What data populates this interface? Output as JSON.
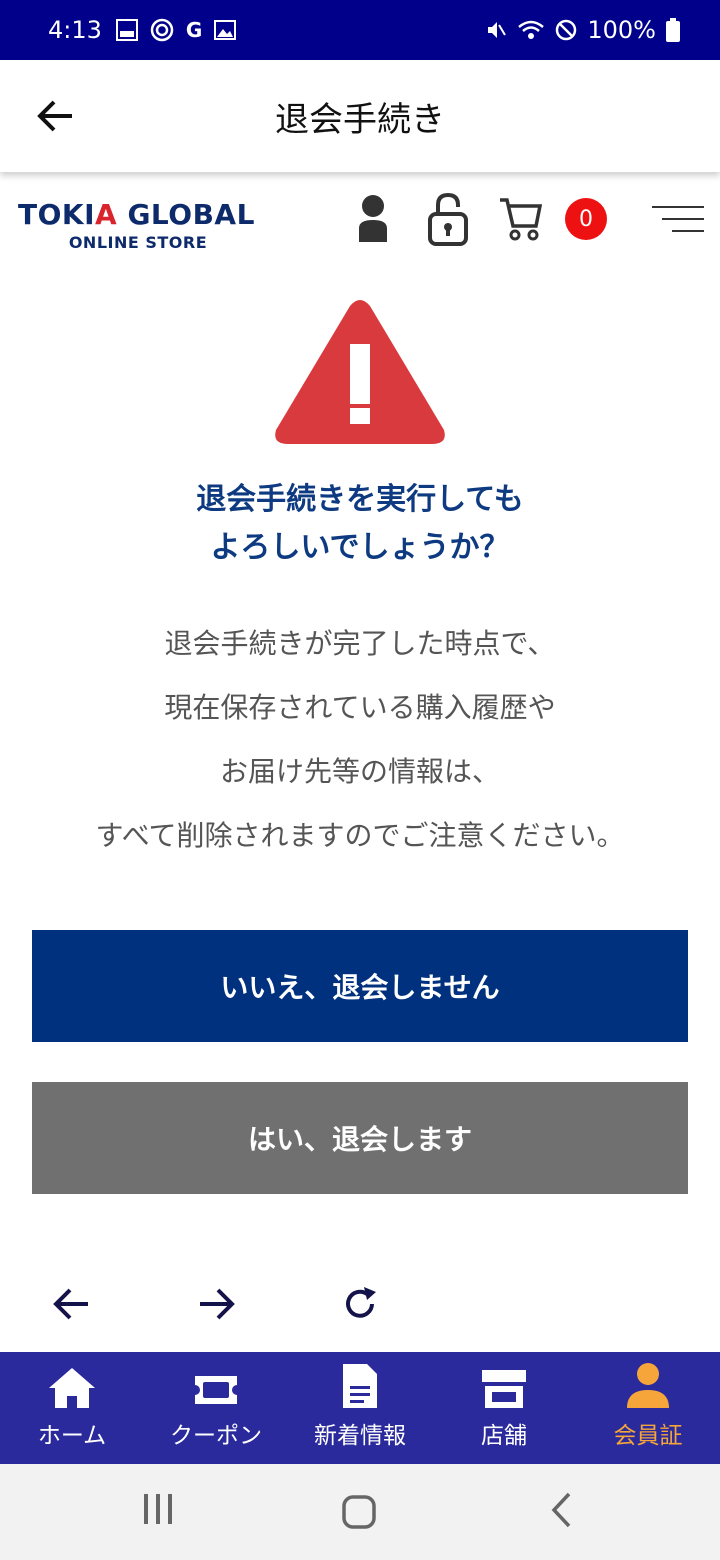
{
  "status_bar": {
    "time": "4:13",
    "battery": "100%",
    "icon_g": "G",
    "icon_life": "LIFE"
  },
  "app_bar": {
    "title": "退会手続き"
  },
  "site_header": {
    "logo_main_1": "TOKI",
    "logo_main_a": "A",
    "logo_main_2": " GLOBAL",
    "logo_sub": "ONLINE STORE",
    "cart_count": "0"
  },
  "confirm": {
    "heading_line1": "退会手続きを実行しても",
    "heading_line2": "よろしいでしょうか？",
    "body_line1": "退会手続きが完了した時点で、",
    "body_line2": "現在保存されている購入履歴や",
    "body_line3": "お届け先等の情報は、",
    "body_line4": "すべて削除されますのでご注意ください。",
    "no_button": "いいえ、退会しません",
    "yes_button": "はい、退会します"
  },
  "tabs": [
    {
      "label": "ホーム",
      "icon": "home-icon"
    },
    {
      "label": "クーポン",
      "icon": "ticket-icon"
    },
    {
      "label": "新着情報",
      "icon": "document-icon"
    },
    {
      "label": "店舗",
      "icon": "store-icon"
    },
    {
      "label": "会員証",
      "icon": "person-icon",
      "active": true
    }
  ],
  "colors": {
    "status_bar": "#00008b",
    "primary": "#00317e",
    "secondary": "#707070",
    "tab_bar": "#2a2a9c",
    "tab_active": "#f5a53a",
    "warning": "#d93a3e"
  }
}
